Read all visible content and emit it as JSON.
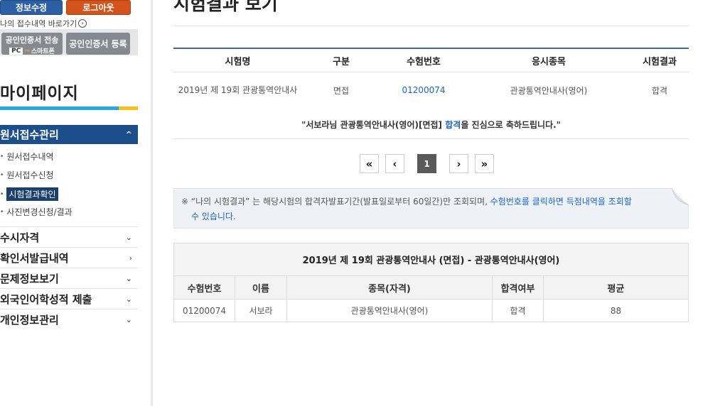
{
  "sidebar": {
    "edit_info": "정보수정",
    "logout": "로그아웃",
    "receipt_link": "나의 접수내역 바로가기",
    "cert_transfer": "공인인증서 전송",
    "cert_pc": "PC",
    "cert_phone": "스마트폰",
    "cert_register": "공인인증서 등록",
    "mypage_title": "마이페이지",
    "active_menu": "원서접수관리",
    "sub_items": [
      {
        "label": "원서접수내역"
      },
      {
        "label": "원서접수신청"
      },
      {
        "label": "시험결과확인"
      },
      {
        "label": "사진변경신청/결과"
      }
    ],
    "menu_items": [
      {
        "label": "수시자격"
      },
      {
        "label": "확인서발급내역"
      },
      {
        "label": "문제정보보기"
      },
      {
        "label": "외국인어학성적 제출"
      },
      {
        "label": "개인정보관리"
      }
    ]
  },
  "main": {
    "title": "시험결과 보기",
    "result_table": {
      "headers": [
        "시험명",
        "구분",
        "수험번호",
        "응시종목",
        "시험결과"
      ],
      "row": {
        "exam_name": "2019년 제 19회 관광통역안내사",
        "type": "면접",
        "exam_no": "01200074",
        "subject": "관광통역안내사(영어)",
        "result": "합격"
      }
    },
    "congrats": {
      "prefix": "\"서보라님 관광통역안내사(영어)[면접] ",
      "highlight": "합격",
      "suffix": "을 진심으로 축하드립니다.\""
    },
    "pagination": {
      "first": "«",
      "prev": "‹",
      "current": "1",
      "next": "›",
      "last": "»"
    },
    "notice": {
      "mark": "※",
      "text": " “나의 시험결과” 는 해당시험의 합격자발표기간(발표일로부터 60일간)만 조회되며, ",
      "link_line1": "수험번호를 클릭하면 득점내역을 조회할",
      "link_line2": "수 있습니다."
    },
    "score_table": {
      "caption": "2019년 제 19회 관광통역안내사 (면접) - 관광통역안내사(영어)",
      "headers": [
        "수험번호",
        "이름",
        "종목(자격)",
        "합격여부",
        "평균"
      ],
      "row": [
        "01200074",
        "서보라",
        "관광통역안내사(영어)",
        "합격",
        "88"
      ]
    }
  },
  "colors": {
    "nav_active": "#1b4e8a",
    "link": "#1a64c6",
    "accent_blue": "#29a8e0",
    "accent_yellow": "#f5c21a",
    "logout": "#d2541c",
    "edit": "#2d5fa5"
  }
}
